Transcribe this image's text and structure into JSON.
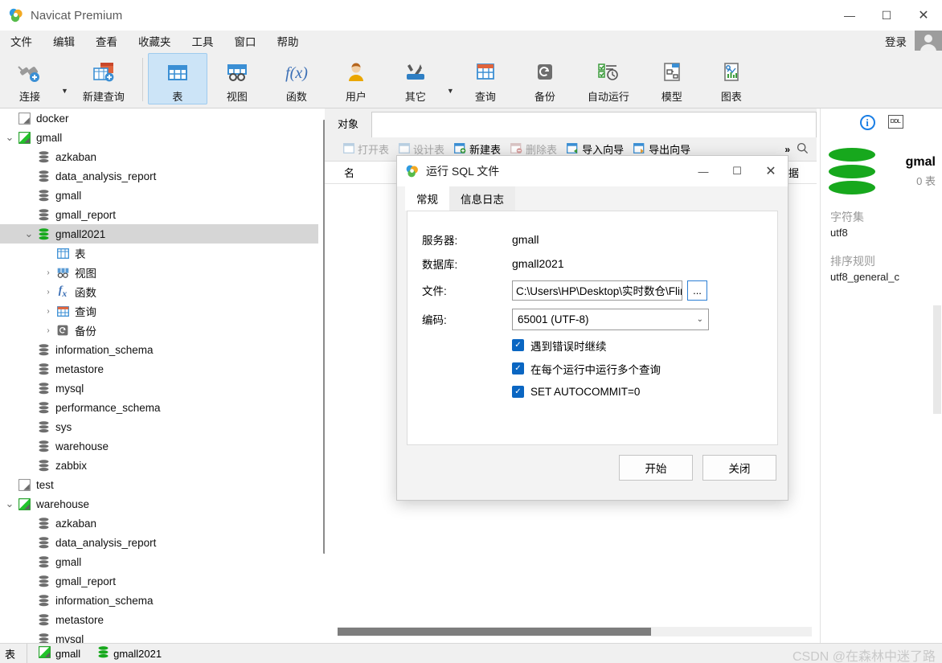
{
  "window": {
    "app_title": "Navicat Premium",
    "minimize": "—",
    "maximize": "☐",
    "close": "✕"
  },
  "menubar": {
    "items": [
      {
        "label": "文件"
      },
      {
        "label": "编辑"
      },
      {
        "label": "查看"
      },
      {
        "label": "收藏夹"
      },
      {
        "label": "工具"
      },
      {
        "label": "窗口"
      },
      {
        "label": "帮助"
      }
    ],
    "login_label": "登录"
  },
  "ribbon": {
    "items": [
      {
        "label": "连接",
        "icon": "connection-icon"
      },
      {
        "label": "新建查询",
        "icon": "new-query-icon"
      },
      {
        "label": "表",
        "icon": "table-icon"
      },
      {
        "label": "视图",
        "icon": "view-icon"
      },
      {
        "label": "函数",
        "icon": "function-icon"
      },
      {
        "label": "用户",
        "icon": "user-icon"
      },
      {
        "label": "其它",
        "icon": "other-icon"
      },
      {
        "label": "查询",
        "icon": "query-icon"
      },
      {
        "label": "备份",
        "icon": "backup-icon"
      },
      {
        "label": "自动运行",
        "icon": "automation-icon"
      },
      {
        "label": "模型",
        "icon": "model-icon"
      },
      {
        "label": "图表",
        "icon": "chart-icon"
      }
    ],
    "active_index": 2
  },
  "sidebar": {
    "rows": [
      {
        "label": "docker",
        "indent": 0,
        "icon": "connection-grey",
        "twisty": "",
        "selected": false
      },
      {
        "label": "gmall",
        "indent": 0,
        "icon": "connection-green",
        "twisty": "⌄",
        "selected": false
      },
      {
        "label": "azkaban",
        "indent": 1,
        "icon": "database",
        "twisty": "",
        "selected": false
      },
      {
        "label": "data_analysis_report",
        "indent": 1,
        "icon": "database",
        "twisty": "",
        "selected": false
      },
      {
        "label": "gmall",
        "indent": 1,
        "icon": "database",
        "twisty": "",
        "selected": false
      },
      {
        "label": "gmall_report",
        "indent": 1,
        "icon": "database",
        "twisty": "",
        "selected": false
      },
      {
        "label": "gmall2021",
        "indent": 1,
        "icon": "database-green",
        "twisty": "⌄",
        "selected": true
      },
      {
        "label": "表",
        "indent": 2,
        "icon": "grid",
        "twisty": "",
        "selected": false
      },
      {
        "label": "视图",
        "indent": 2,
        "icon": "view",
        "twisty": "›",
        "selected": false
      },
      {
        "label": "函数",
        "indent": 2,
        "icon": "fx",
        "twisty": "›",
        "selected": false
      },
      {
        "label": "查询",
        "indent": 2,
        "icon": "queryfile",
        "twisty": "›",
        "selected": false
      },
      {
        "label": "备份",
        "indent": 2,
        "icon": "backup",
        "twisty": "›",
        "selected": false
      },
      {
        "label": "information_schema",
        "indent": 1,
        "icon": "database",
        "twisty": "",
        "selected": false
      },
      {
        "label": "metastore",
        "indent": 1,
        "icon": "database",
        "twisty": "",
        "selected": false
      },
      {
        "label": "mysql",
        "indent": 1,
        "icon": "database",
        "twisty": "",
        "selected": false
      },
      {
        "label": "performance_schema",
        "indent": 1,
        "icon": "database",
        "twisty": "",
        "selected": false
      },
      {
        "label": "sys",
        "indent": 1,
        "icon": "database",
        "twisty": "",
        "selected": false
      },
      {
        "label": "warehouse",
        "indent": 1,
        "icon": "database",
        "twisty": "",
        "selected": false
      },
      {
        "label": "zabbix",
        "indent": 1,
        "icon": "database",
        "twisty": "",
        "selected": false
      },
      {
        "label": "test",
        "indent": 0,
        "icon": "connection-grey",
        "twisty": "",
        "selected": false
      },
      {
        "label": "warehouse",
        "indent": 0,
        "icon": "connection-green",
        "twisty": "⌄",
        "selected": false
      },
      {
        "label": "azkaban",
        "indent": 1,
        "icon": "database",
        "twisty": "",
        "selected": false
      },
      {
        "label": "data_analysis_report",
        "indent": 1,
        "icon": "database",
        "twisty": "",
        "selected": false
      },
      {
        "label": "gmall",
        "indent": 1,
        "icon": "database",
        "twisty": "",
        "selected": false
      },
      {
        "label": "gmall_report",
        "indent": 1,
        "icon": "database",
        "twisty": "",
        "selected": false
      },
      {
        "label": "information_schema",
        "indent": 1,
        "icon": "database",
        "twisty": "",
        "selected": false
      },
      {
        "label": "metastore",
        "indent": 1,
        "icon": "database",
        "twisty": "",
        "selected": false
      },
      {
        "label": "mysql",
        "indent": 1,
        "icon": "database",
        "twisty": "",
        "selected": false
      }
    ]
  },
  "main": {
    "object_tab": "对象",
    "toolbar": [
      {
        "label": "打开表",
        "enabled": false
      },
      {
        "label": "设计表",
        "enabled": false
      },
      {
        "label": "新建表",
        "enabled": true
      },
      {
        "label": "删除表",
        "enabled": false
      },
      {
        "label": "导入向导",
        "enabled": true
      },
      {
        "label": "导出向导",
        "enabled": true
      }
    ],
    "overflow": "»",
    "search_icon": "search-icon",
    "columns": [
      "名",
      "数据"
    ]
  },
  "info_panel": {
    "info_icon": "i",
    "ddl_icon": "DDL",
    "db_name": "gmal",
    "table_count": "0 表",
    "charset_label": "字符集",
    "charset_value": "utf8",
    "collation_label": "排序规则",
    "collation_value": "utf8_general_c"
  },
  "statusbar": {
    "left_label": "表",
    "items": [
      {
        "label": "gmall",
        "icon": "connection-green"
      },
      {
        "label": "gmall2021",
        "icon": "database-green"
      }
    ],
    "watermark": "CSDN @在森林中迷了路"
  },
  "dialog": {
    "title": "运行 SQL 文件",
    "minimize": "—",
    "maximize": "☐",
    "close": "✕",
    "tabs": [
      {
        "label": "常规",
        "active": true
      },
      {
        "label": "信息日志",
        "active": false
      }
    ],
    "fields": {
      "server_label": "服务器:",
      "server_value": "gmall",
      "database_label": "数据库:",
      "database_value": "gmall2021",
      "file_label": "文件:",
      "file_value": "C:\\Users\\HP\\Desktop\\实时数仓\\Flink实时数",
      "browse_label": "...",
      "encoding_label": "编码:",
      "encoding_value": "65001 (UTF-8)",
      "encoding_caret": "⌄"
    },
    "checkboxes": [
      {
        "label": "遇到错误时继续",
        "checked": true
      },
      {
        "label": "在每个运行中运行多个查询",
        "checked": true
      },
      {
        "label": "SET AUTOCOMMIT=0",
        "checked": true
      }
    ],
    "check_mark": "✓",
    "start_button": "开始",
    "close_button": "关闭"
  },
  "colors": {
    "accent": "#0a66c2",
    "green": "#17a81d",
    "ribbon_active": "#cce4f7",
    "selection": "#d6d6d6"
  }
}
